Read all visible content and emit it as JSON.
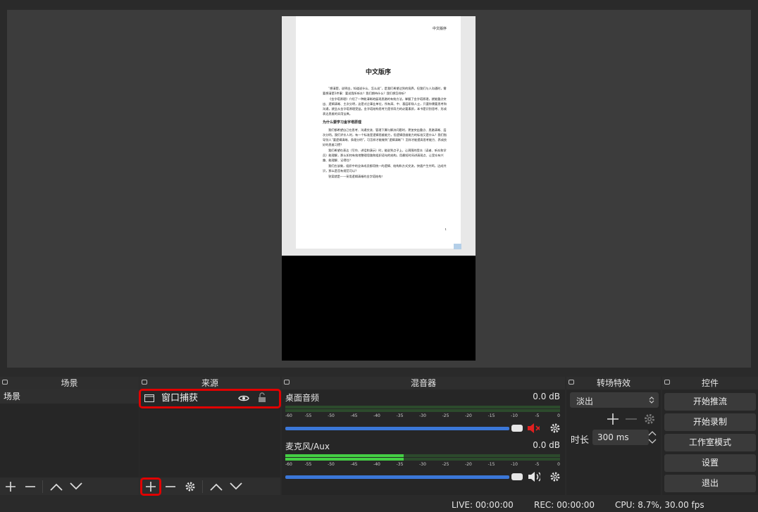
{
  "preview": {
    "doc_header": "中文版序",
    "doc_title": "中文版序",
    "paragraphs": [
      "“想清楚，说明白，知道说什么、怎么说”，是我们希望达到的境界，但我们与人沟通时，需要想清楚3件事：要说我所听众？我们期待什么？我们想怎样听？",
      "《金字塔原理》介绍了一种能清晰地展现思路的有效方法，掌握了金字塔原理，就能重点突出、逻辑清晰、主次分明，这是对企事业单位，所有高、中、基层职场人士，只要你需要思考和沟通，就会从金字塔原理受益。金字塔结构思考力是领导力的必要素质，本书是识别思考、形成表达思维的实用宝典。"
    ],
    "section_title": "为什么要学习金字塔原理",
    "paragraphs2": [
      "我们都希望自己在思考、沟通交流、管理下属与解决问题时，更加突出重点、思路清晰、层次分明。我们评价人时，有一个标准是逻辑思维能力，但逻辑思维能力的标准又是什么？我们指导别人“要逻辑清晰、条理分明”，可怎样才能做到“逻辑清晰”？怎样才能提高思考能力、养成良好的思维习惯？",
      "我们希望在表达（写作、讲话和演示）时，能说到点子上，让周围的受众（读者、听众和学员）能理解，那么如何有效地整理思路和组织语句的结构，用最短时间讲清观点、让受众有兴趣、能理解、记得住？",
      "我们应该做，组织中的全体成员都用统一的逻辑、结构和方式交流，快速产生共鸣，达成共识，那么是否有规范可以？",
      "答案就是——采用逻辑清晰的金字塔结构！"
    ],
    "page_number": "1"
  },
  "docks": {
    "scenes": {
      "title": "场景",
      "items": [
        "场景"
      ]
    },
    "sources": {
      "title": "来源",
      "items": [
        {
          "label": "窗口捕获"
        }
      ]
    },
    "mixer": {
      "title": "混音器",
      "channels": [
        {
          "name": "桌面音频",
          "db": "0.0 dB",
          "level": 0,
          "muted": true
        },
        {
          "name": "麦克风/Aux",
          "db": "0.0 dB",
          "level": 0.43,
          "muted": false
        }
      ],
      "ticks": [
        "-60",
        "-55",
        "-50",
        "-45",
        "-40",
        "-35",
        "-30",
        "-25",
        "-20",
        "-15",
        "-10",
        "-5",
        "0"
      ]
    },
    "transitions": {
      "title": "转场特效",
      "selected": "淡出",
      "duration_label": "时长",
      "duration_value": "300 ms"
    },
    "controls": {
      "title": "控件",
      "buttons": [
        "开始推流",
        "开始录制",
        "工作室模式",
        "设置",
        "退出"
      ]
    }
  },
  "status": {
    "live": "LIVE: 00:00:00",
    "rec": "REC: 00:00:00",
    "cpu": "CPU: 8.7%, 30.00 fps"
  },
  "colors": {
    "accent_red": "#e00000",
    "fader_blue": "#3b77d8",
    "meter_green": "#44d044"
  }
}
